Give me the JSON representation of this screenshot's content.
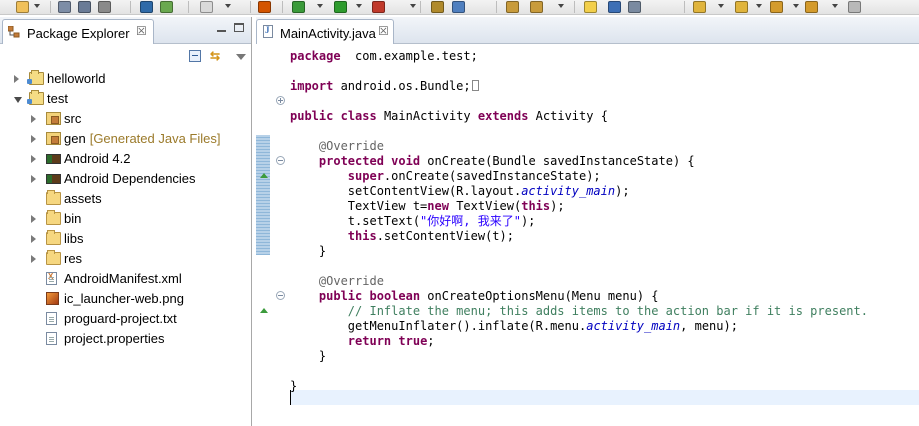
{
  "toolbar": {
    "icons": [
      "new-icon",
      "save-icon",
      "save-all-icon",
      "print-icon",
      "import-icon",
      "android-sdk-icon",
      "tasks-icon",
      "android-lint-icon",
      "debug-icon",
      "run-icon",
      "external-tools-icon",
      "new-java-package-icon",
      "new-java-class-icon",
      "open-type-icon",
      "search-icon",
      "toggle-mark-occurrences-icon",
      "show-whitespace-icon",
      "pin-editor-icon",
      "next-annotation-icon",
      "previous-annotation-icon",
      "last-edit-location-icon",
      "back-icon",
      "forward-icon"
    ]
  },
  "package_explorer": {
    "tab_label": "Package Explorer",
    "tab_close": "☒",
    "tree": [
      {
        "label": "helloworld",
        "decoration": "",
        "icon": "project-icon",
        "level": 0,
        "expander": "closed"
      },
      {
        "label": "test",
        "decoration": "",
        "icon": "project-icon",
        "level": 0,
        "expander": "open"
      },
      {
        "label": "src",
        "decoration": "",
        "icon": "source-folder-icon",
        "level": 1,
        "expander": "closed"
      },
      {
        "label": "gen",
        "decoration": "[Generated Java Files]",
        "icon": "source-folder-icon",
        "level": 1,
        "expander": "closed"
      },
      {
        "label": "Android 4.2",
        "decoration": "",
        "icon": "library-icon",
        "level": 1,
        "expander": "closed"
      },
      {
        "label": "Android Dependencies",
        "decoration": "",
        "icon": "library-icon",
        "level": 1,
        "expander": "closed"
      },
      {
        "label": "assets",
        "decoration": "",
        "icon": "folder-icon",
        "level": 1,
        "expander": "none"
      },
      {
        "label": "bin",
        "decoration": "",
        "icon": "folder-icon",
        "level": 1,
        "expander": "closed"
      },
      {
        "label": "libs",
        "decoration": "",
        "icon": "folder-icon",
        "level": 1,
        "expander": "closed"
      },
      {
        "label": "res",
        "decoration": "",
        "icon": "folder-icon",
        "level": 1,
        "expander": "closed"
      },
      {
        "label": "AndroidManifest.xml",
        "decoration": "",
        "icon": "xml-file-icon",
        "level": 1,
        "expander": "none"
      },
      {
        "label": "ic_launcher-web.png",
        "decoration": "",
        "icon": "image-file-icon",
        "level": 1,
        "expander": "none"
      },
      {
        "label": "proguard-project.txt",
        "decoration": "",
        "icon": "text-file-icon",
        "level": 1,
        "expander": "none"
      },
      {
        "label": "project.properties",
        "decoration": "",
        "icon": "text-file-icon",
        "level": 1,
        "expander": "none"
      }
    ]
  },
  "editor": {
    "tab_label": "MainActivity.java",
    "tab_close": "☒",
    "lines": [
      [
        [
          "kw",
          "package"
        ],
        [
          "",
          "  com.example.test;"
        ]
      ],
      [],
      [
        [
          "kw",
          "import"
        ],
        [
          "",
          " android.os.Bundle;"
        ],
        [
          "box",
          ""
        ]
      ],
      [],
      [
        [
          "kw",
          "public"
        ],
        [
          "",
          " "
        ],
        [
          "kw",
          "class"
        ],
        [
          "",
          " MainActivity "
        ],
        [
          "kw",
          "extends"
        ],
        [
          "",
          " Activity {"
        ]
      ],
      [],
      [
        [
          "",
          "    "
        ],
        [
          "ann",
          "@Override"
        ]
      ],
      [
        [
          "",
          "    "
        ],
        [
          "kw",
          "protected"
        ],
        [
          "",
          " "
        ],
        [
          "kw",
          "void"
        ],
        [
          "",
          " onCreate(Bundle savedInstanceState) {"
        ]
      ],
      [
        [
          "",
          "        "
        ],
        [
          "kw",
          "super"
        ],
        [
          "",
          ".onCreate(savedInstanceState);"
        ]
      ],
      [
        [
          "",
          "        setContentView(R.layout."
        ],
        [
          "fld",
          "activity_main"
        ],
        [
          "",
          ");"
        ]
      ],
      [
        [
          "",
          "        TextView t="
        ],
        [
          "kw",
          "new"
        ],
        [
          "",
          " TextView("
        ],
        [
          "kw",
          "this"
        ],
        [
          "",
          ");"
        ]
      ],
      [
        [
          "",
          "        t.setText("
        ],
        [
          "str",
          "\"你好啊, 我来了\""
        ],
        [
          "",
          ");"
        ]
      ],
      [
        [
          "",
          "        "
        ],
        [
          "kw",
          "this"
        ],
        [
          "",
          ".setContentView(t);"
        ]
      ],
      [
        [
          "",
          "    }"
        ]
      ],
      [],
      [
        [
          "",
          "    "
        ],
        [
          "ann",
          "@Override"
        ]
      ],
      [
        [
          "",
          "    "
        ],
        [
          "kw",
          "public"
        ],
        [
          "",
          " "
        ],
        [
          "kw",
          "boolean"
        ],
        [
          "",
          " onCreateOptionsMenu(Menu menu) {"
        ]
      ],
      [
        [
          "",
          "        "
        ],
        [
          "cmt",
          "// Inflate the menu; this adds items to the action bar if it is present."
        ]
      ],
      [
        [
          "",
          "        getMenuInflater().inflate(R.menu."
        ],
        [
          "fld",
          "activity_main"
        ],
        [
          "",
          ", menu);"
        ]
      ],
      [
        [
          "",
          "        "
        ],
        [
          "kw",
          "return"
        ],
        [
          "",
          " "
        ],
        [
          "kw",
          "true"
        ],
        [
          "",
          ";"
        ]
      ],
      [
        [
          "",
          "    }"
        ]
      ],
      [],
      [
        [
          "",
          "}"
        ]
      ]
    ]
  },
  "colors": {
    "keyword": "#7f0055",
    "annotation": "#646464",
    "comment": "#3f7f5f",
    "string": "#2a00ff",
    "field": "#0000c0",
    "current_line": "#e8f2fe"
  }
}
